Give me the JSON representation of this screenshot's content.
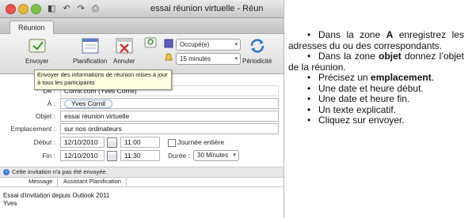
{
  "window": {
    "title": "essai réunion virtuelle - Réun",
    "toolbar_icons": "◧ ↶ ↷ ⎙"
  },
  "ribbon": {
    "tab": "Réunion",
    "buttons": {
      "send": "Envoyer",
      "planning": "Planification",
      "cancel": "Annuler"
    },
    "show_as": "Occupé(e)",
    "reminder": "15 minutes",
    "recurrence": "Périodicité"
  },
  "tooltip": "Envoyer des informations de réunion mises à jour à tous les participants",
  "form": {
    "from_label": "De :",
    "from_value": "Cornil.com (Yves Cornil)",
    "to_label": "À :",
    "to_value": "Yves Cornil",
    "subject_label": "Objet :",
    "subject_value": "essai réunion virtuelle",
    "location_label": "Emplacement :",
    "location_value": "sur nos ordinateurs",
    "start_label": "Début :",
    "start_date": "12/10/2010",
    "start_time": "11:00",
    "all_day_label": "Journée entière",
    "end_label": "Fin :",
    "end_date": "12/10/2010",
    "end_time": "11:30",
    "duration_label": "Durée :",
    "duration_value": "30 Minutes"
  },
  "infobar": "Cette invitation n'a pas été envoyée.",
  "subtabs": [
    "Message",
    "Assistant Planification"
  ],
  "message_body": [
    "Essai d'invitation depuis Outlook 2011",
    "Yves"
  ],
  "notes": [
    {
      "text_before": "Dans la zone ",
      "bold": "A",
      "text_after": " enregistrez les adresses du ou des correspondants."
    },
    {
      "text_before": "Dans la zone ",
      "bold": "objet",
      "text_after": " donnez l’objet de la réunion."
    },
    {
      "text_before": "Précisez un ",
      "bold": "emplacement",
      "text_after": "."
    },
    {
      "text_before": "Une date et heure début.",
      "bold": "",
      "text_after": ""
    },
    {
      "text_before": "Une date et heure fin.",
      "bold": "",
      "text_after": ""
    },
    {
      "text_before": "Un texte explicatif.",
      "bold": "",
      "text_after": ""
    },
    {
      "text_before": "Cliquez sur envoyer.",
      "bold": "",
      "text_after": ""
    }
  ],
  "bullet_char": "•"
}
